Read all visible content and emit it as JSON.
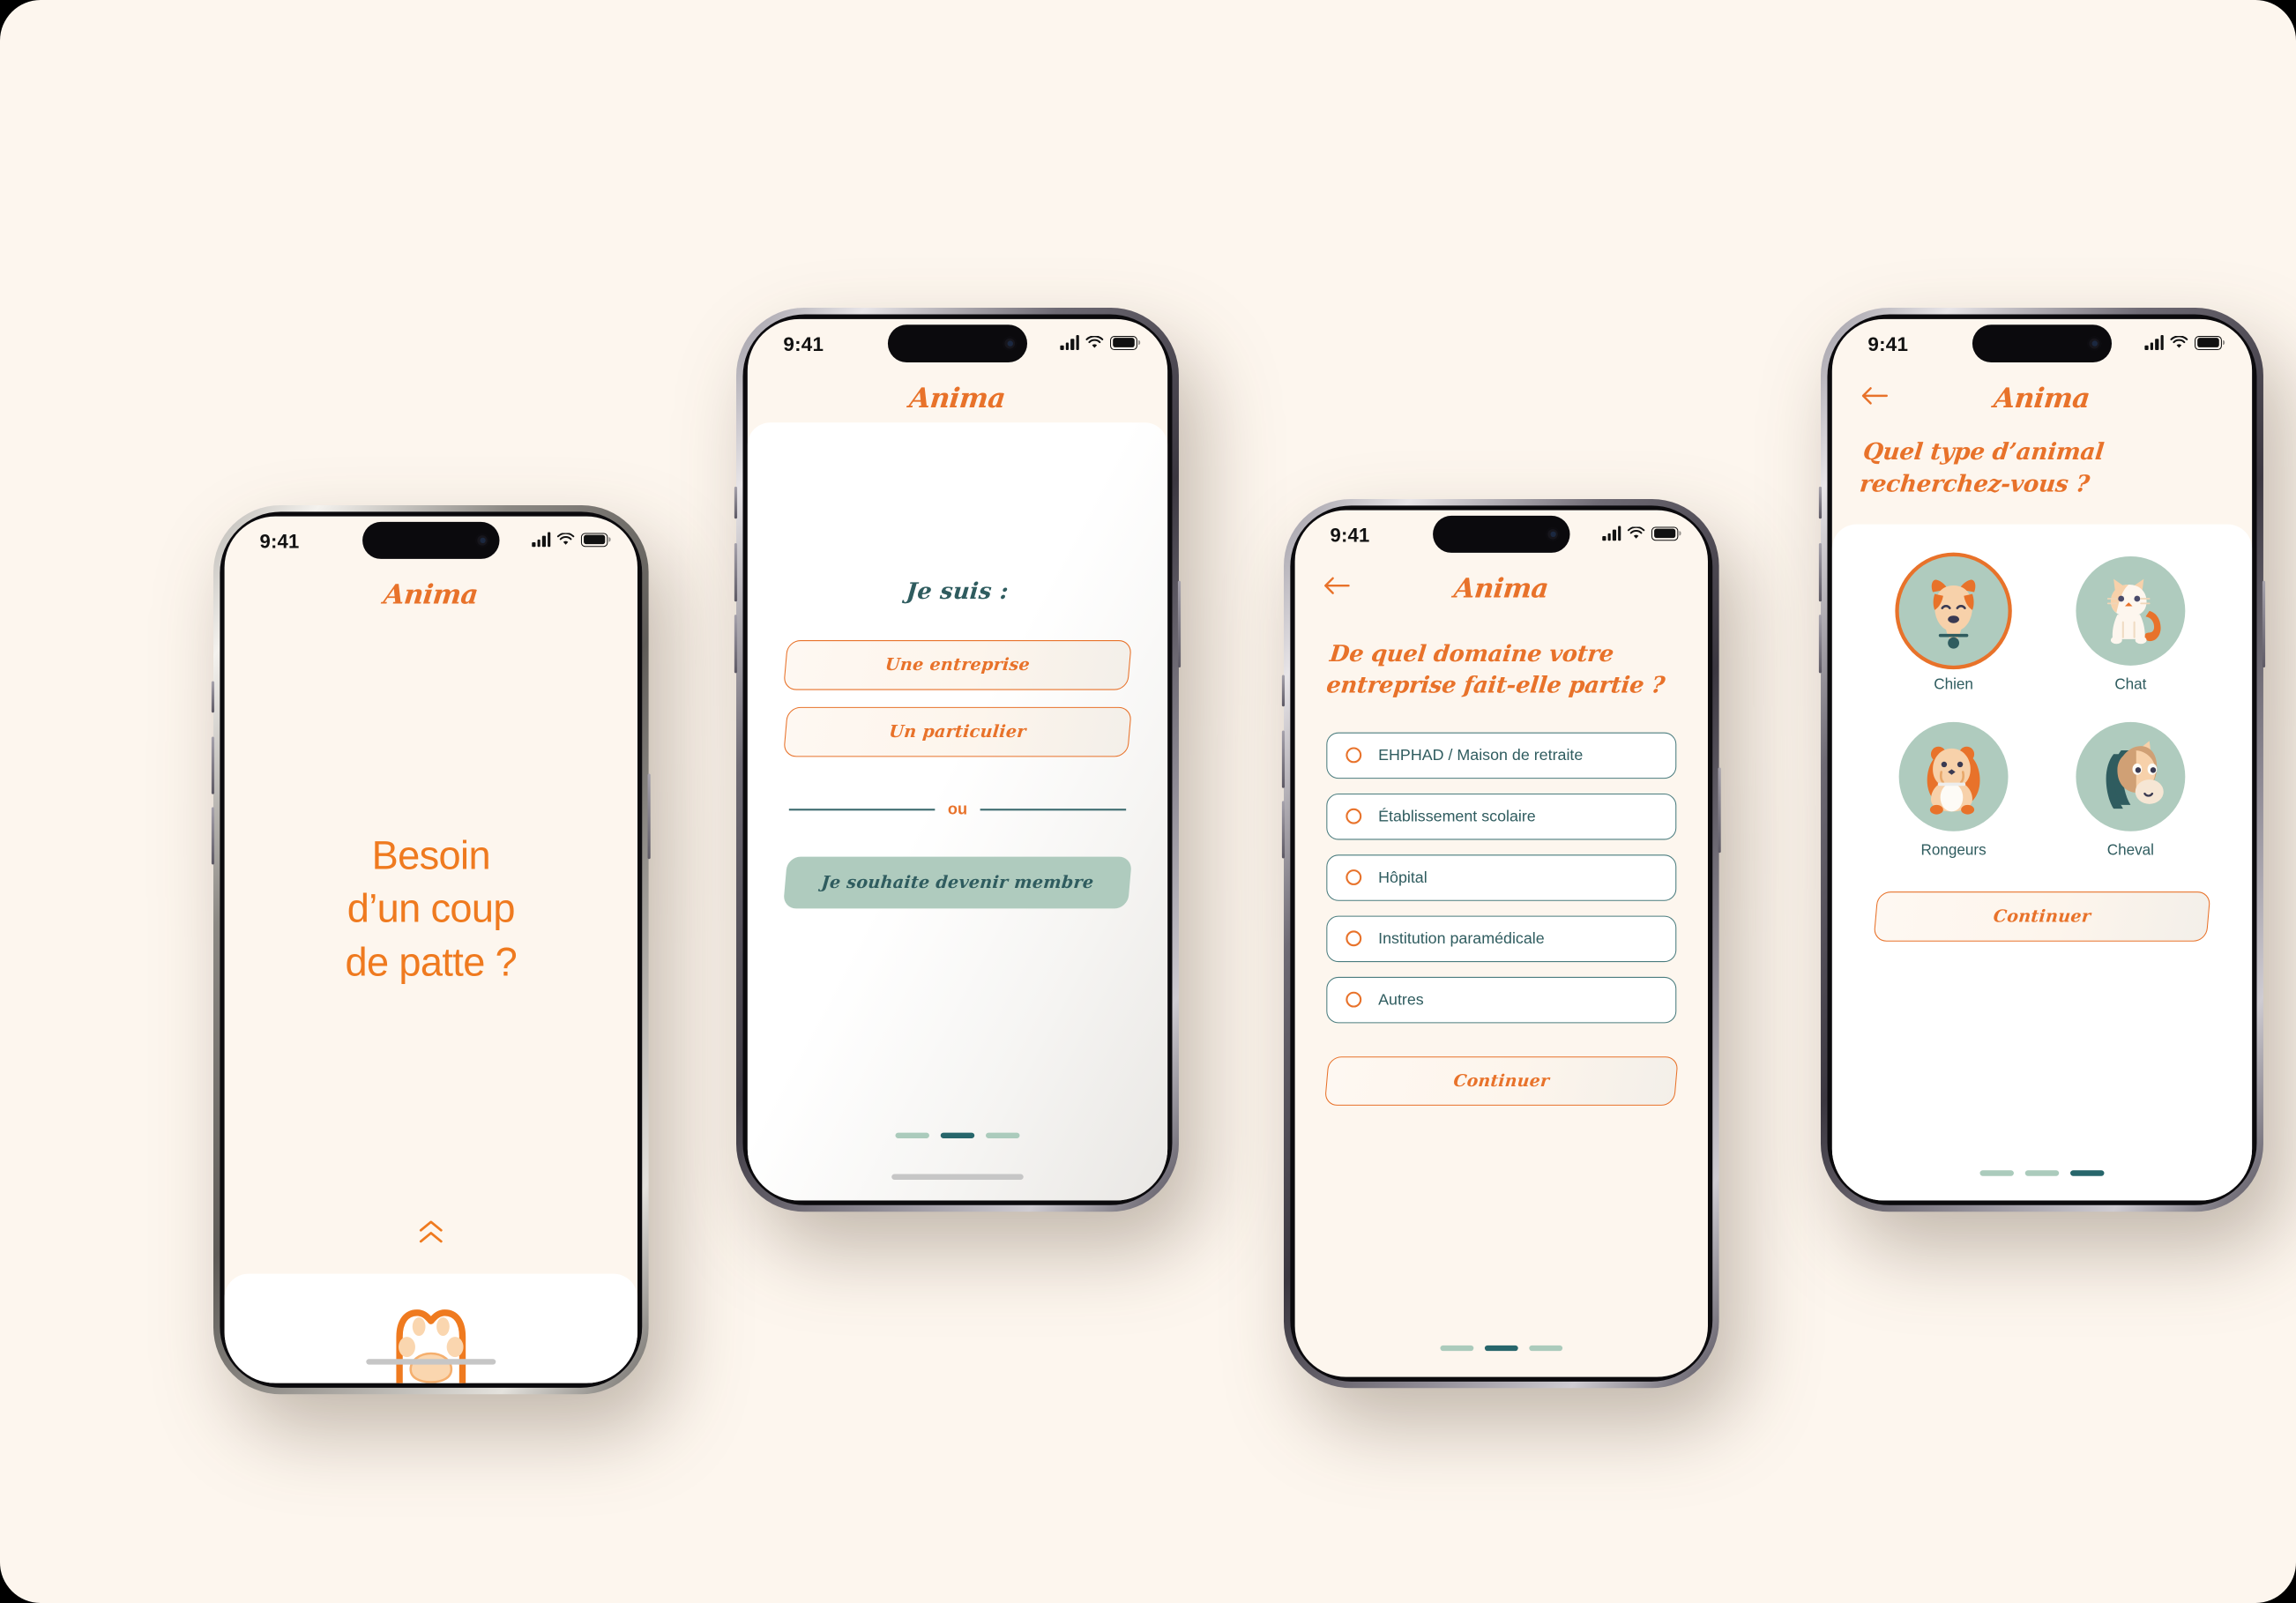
{
  "app": {
    "brand": "Anima",
    "accent_orange": "#E8722A",
    "accent_teal": "#2F5C5F",
    "accent_sage": "#AFCBBE",
    "bg_cream": "#FDF6EE"
  },
  "status_bar": {
    "time": "9:41",
    "icons": [
      "cellular-signal-icon",
      "wifi-icon",
      "battery-icon"
    ]
  },
  "screens": [
    {
      "id": "splash",
      "brand": "Anima",
      "headline_lines": [
        "Besoin",
        "d’un coup",
        "de patte ?"
      ],
      "scroll_hint_icon": "double-chevron-up-icon",
      "paw_icon": "cat-paw-icon"
    },
    {
      "id": "role-select",
      "brand": "Anima",
      "heading": "Je suis :",
      "buttons": [
        {
          "label": "Une entreprise",
          "style": "outline"
        },
        {
          "label": "Un particulier",
          "style": "outline"
        }
      ],
      "divider_label": "ou",
      "member_button": {
        "label": "Je souhaite devenir membre",
        "style": "filled"
      },
      "progress": {
        "total": 3,
        "active": 2
      }
    },
    {
      "id": "company-domain",
      "brand": "Anima",
      "back_icon": "arrow-left-icon",
      "question": "De quel domaine votre entreprise fait-elle partie ?",
      "options": [
        "EHPHAD / Maison de retraite",
        "Établissement scolaire",
        "Hôpital",
        "Institution paramédicale",
        "Autres"
      ],
      "selected_option": null,
      "cta": "Continuer",
      "progress": {
        "total": 3,
        "active": 2
      }
    },
    {
      "id": "animal-type",
      "brand": "Anima",
      "back_icon": "arrow-left-icon",
      "question": "Quel type d’animal recherchez-vous ?",
      "animals": [
        {
          "name": "Chien",
          "icon": "dog-icon",
          "selected": true
        },
        {
          "name": "Chat",
          "icon": "cat-icon",
          "selected": false
        },
        {
          "name": "Rongeurs",
          "icon": "hamster-icon",
          "selected": false
        },
        {
          "name": "Cheval",
          "icon": "horse-icon",
          "selected": false
        }
      ],
      "cta": "Continuer",
      "progress": {
        "total": 3,
        "active": 3
      }
    }
  ]
}
